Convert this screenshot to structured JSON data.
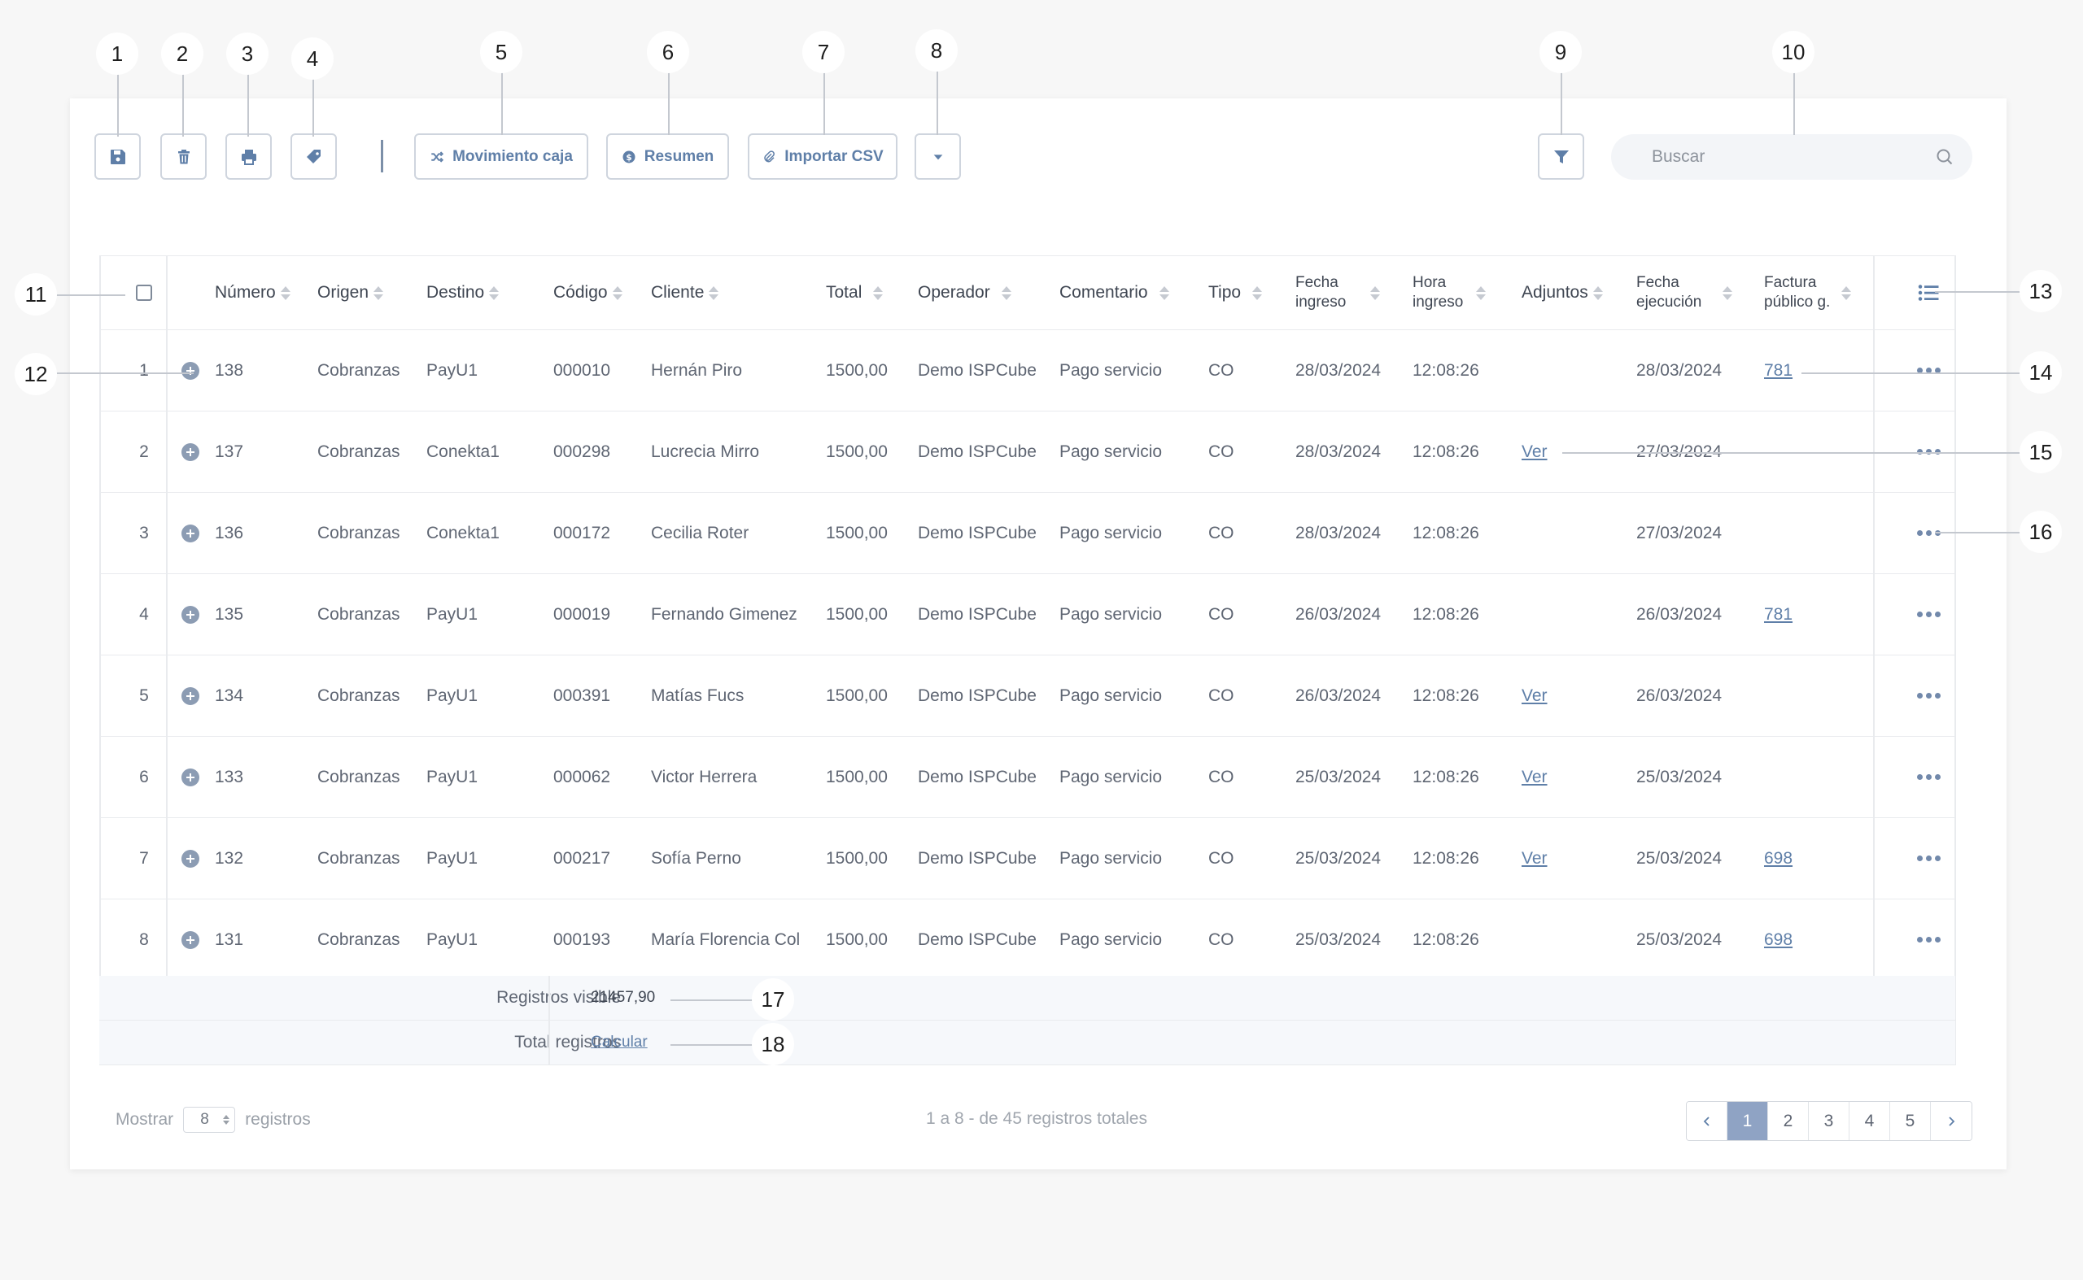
{
  "callouts": [
    "1",
    "2",
    "3",
    "4",
    "5",
    "6",
    "7",
    "8",
    "9",
    "10",
    "11",
    "12",
    "13",
    "14",
    "15",
    "16",
    "17",
    "18"
  ],
  "toolbar": {
    "icons": {
      "save": "floppy-disk-icon",
      "delete": "trash-icon",
      "print": "printer-icon",
      "tag": "tag-icon",
      "filter": "filter-icon",
      "search": "search-icon"
    },
    "movimiento_label": "Movimiento caja",
    "resumen_label": "Resumen",
    "importar_label": "Importar CSV",
    "search_placeholder": "Buscar"
  },
  "table": {
    "headers": {
      "numero": "Número",
      "origen": "Origen",
      "destino": "Destino",
      "codigo": "Código",
      "cliente": "Cliente",
      "total": "Total",
      "operador": "Operador",
      "comentario": "Comentario",
      "tipo": "Tipo",
      "fecha_ingreso_1": "Fecha",
      "fecha_ingreso_2": "ingreso",
      "hora_ingreso_1": "Hora",
      "hora_ingreso_2": "ingreso",
      "adjuntos": "Adjuntos",
      "fecha_ejecucion_1": "Fecha",
      "fecha_ejecucion_2": "ejecución",
      "factura_1": "Factura",
      "factura_2": "público g."
    },
    "rows": [
      {
        "idx": "1",
        "numero": "138",
        "origen": "Cobranzas",
        "destino": "PayU1",
        "codigo": "000010",
        "cliente": "Hernán Piro",
        "total": "1500,00",
        "operador": "Demo ISPCube",
        "comentario": "Pago servicio",
        "tipo": "CO",
        "fecha_ingreso": "28/03/2024",
        "hora_ingreso": "12:08:26",
        "adjuntos": "",
        "fecha_ejecucion": "28/03/2024",
        "factura": "781"
      },
      {
        "idx": "2",
        "numero": "137",
        "origen": "Cobranzas",
        "destino": "Conekta1",
        "codigo": "000298",
        "cliente": "Lucrecia Mirro",
        "total": "1500,00",
        "operador": "Demo ISPCube",
        "comentario": "Pago servicio",
        "tipo": "CO",
        "fecha_ingreso": "28/03/2024",
        "hora_ingreso": "12:08:26",
        "adjuntos": "Ver",
        "fecha_ejecucion": "27/03/2024",
        "factura": ""
      },
      {
        "idx": "3",
        "numero": "136",
        "origen": "Cobranzas",
        "destino": "Conekta1",
        "codigo": "000172",
        "cliente": "Cecilia Roter",
        "total": "1500,00",
        "operador": "Demo ISPCube",
        "comentario": "Pago servicio",
        "tipo": "CO",
        "fecha_ingreso": "28/03/2024",
        "hora_ingreso": "12:08:26",
        "adjuntos": "",
        "fecha_ejecucion": "27/03/2024",
        "factura": ""
      },
      {
        "idx": "4",
        "numero": "135",
        "origen": "Cobranzas",
        "destino": "PayU1",
        "codigo": "000019",
        "cliente": "Fernando Gimenez",
        "total": "1500,00",
        "operador": "Demo ISPCube",
        "comentario": "Pago servicio",
        "tipo": "CO",
        "fecha_ingreso": "26/03/2024",
        "hora_ingreso": "12:08:26",
        "adjuntos": "",
        "fecha_ejecucion": "26/03/2024",
        "factura": "781"
      },
      {
        "idx": "5",
        "numero": "134",
        "origen": "Cobranzas",
        "destino": "PayU1",
        "codigo": "000391",
        "cliente": "Matías Fucs",
        "total": "1500,00",
        "operador": "Demo ISPCube",
        "comentario": "Pago servicio",
        "tipo": "CO",
        "fecha_ingreso": "26/03/2024",
        "hora_ingreso": "12:08:26",
        "adjuntos": "Ver",
        "fecha_ejecucion": "26/03/2024",
        "factura": ""
      },
      {
        "idx": "6",
        "numero": "133",
        "origen": "Cobranzas",
        "destino": "PayU1",
        "codigo": "000062",
        "cliente": "Victor Herrera",
        "total": "1500,00",
        "operador": "Demo ISPCube",
        "comentario": "Pago servicio",
        "tipo": "CO",
        "fecha_ingreso": "25/03/2024",
        "hora_ingreso": "12:08:26",
        "adjuntos": "Ver",
        "fecha_ejecucion": "25/03/2024",
        "factura": ""
      },
      {
        "idx": "7",
        "numero": "132",
        "origen": "Cobranzas",
        "destino": "PayU1",
        "codigo": "000217",
        "cliente": "Sofía Perno",
        "total": "1500,00",
        "operador": "Demo ISPCube",
        "comentario": "Pago servicio",
        "tipo": "CO",
        "fecha_ingreso": "25/03/2024",
        "hora_ingreso": "12:08:26",
        "adjuntos": "Ver",
        "fecha_ejecucion": "25/03/2024",
        "factura": "698"
      },
      {
        "idx": "8",
        "numero": "131",
        "origen": "Cobranzas",
        "destino": "PayU1",
        "codigo": "000193",
        "cliente": "María Florencia Col",
        "total": "1500,00",
        "operador": "Demo ISPCube",
        "comentario": "Pago servicio",
        "tipo": "CO",
        "fecha_ingreso": "25/03/2024",
        "hora_ingreso": "12:08:26",
        "adjuntos": "",
        "fecha_ejecucion": "25/03/2024",
        "factura": "698"
      }
    ]
  },
  "summary": {
    "visible_label": "Registros visible",
    "visible_value": "21457,90",
    "total_label": "Total registros",
    "total_link": "Calcular"
  },
  "pagination": {
    "show_label": "Mostrar",
    "page_size": "8",
    "records_label": "registros",
    "info": "1 a 8 - de 45 registros totales",
    "pages": [
      "1",
      "2",
      "3",
      "4",
      "5"
    ],
    "current_page": "1"
  },
  "colors": {
    "accent": "#5f7fa8",
    "active_page": "#8fa3c4",
    "border": "#cfd5de"
  }
}
